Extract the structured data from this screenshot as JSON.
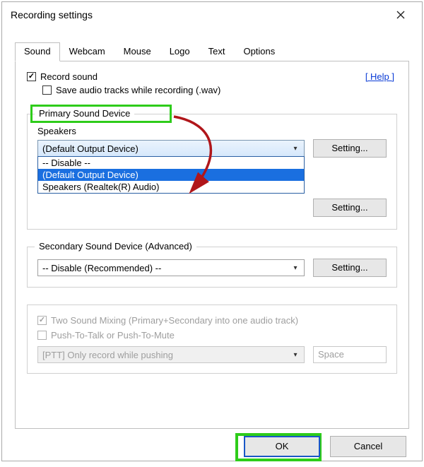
{
  "window": {
    "title": "Recording settings"
  },
  "tabs": {
    "items": [
      "Sound",
      "Webcam",
      "Mouse",
      "Logo",
      "Text",
      "Options"
    ],
    "active_index": 0
  },
  "sound_tab": {
    "record_sound_label": "Record sound",
    "record_sound_checked": true,
    "save_wav_label": "Save audio tracks while recording (.wav)",
    "save_wav_checked": false,
    "help_label": "[ Help ]"
  },
  "primary_group": {
    "title": "Primary Sound Device",
    "speakers_label": "Speakers",
    "speakers_selected": "(Default Output Device)",
    "speakers_options": [
      "-- Disable --",
      "(Default Output Device)",
      "Speakers (Realtek(R) Audio)"
    ],
    "speakers_options_selected_index": 1,
    "setting_label": "Setting..."
  },
  "secondary_group": {
    "title": "Secondary Sound Device (Advanced)",
    "selected": "-- Disable (Recommended) --",
    "setting_label": "Setting..."
  },
  "mixing": {
    "two_sound_label": "Two Sound Mixing (Primary+Secondary into one audio track)",
    "two_sound_checked": true,
    "ptt_checkbox_label": "Push-To-Talk or Push-To-Mute",
    "ptt_checkbox_checked": false,
    "ptt_mode": "[PTT] Only record while pushing",
    "ptt_hotkey": "Space"
  },
  "buttons": {
    "ok": "OK",
    "cancel": "Cancel"
  }
}
